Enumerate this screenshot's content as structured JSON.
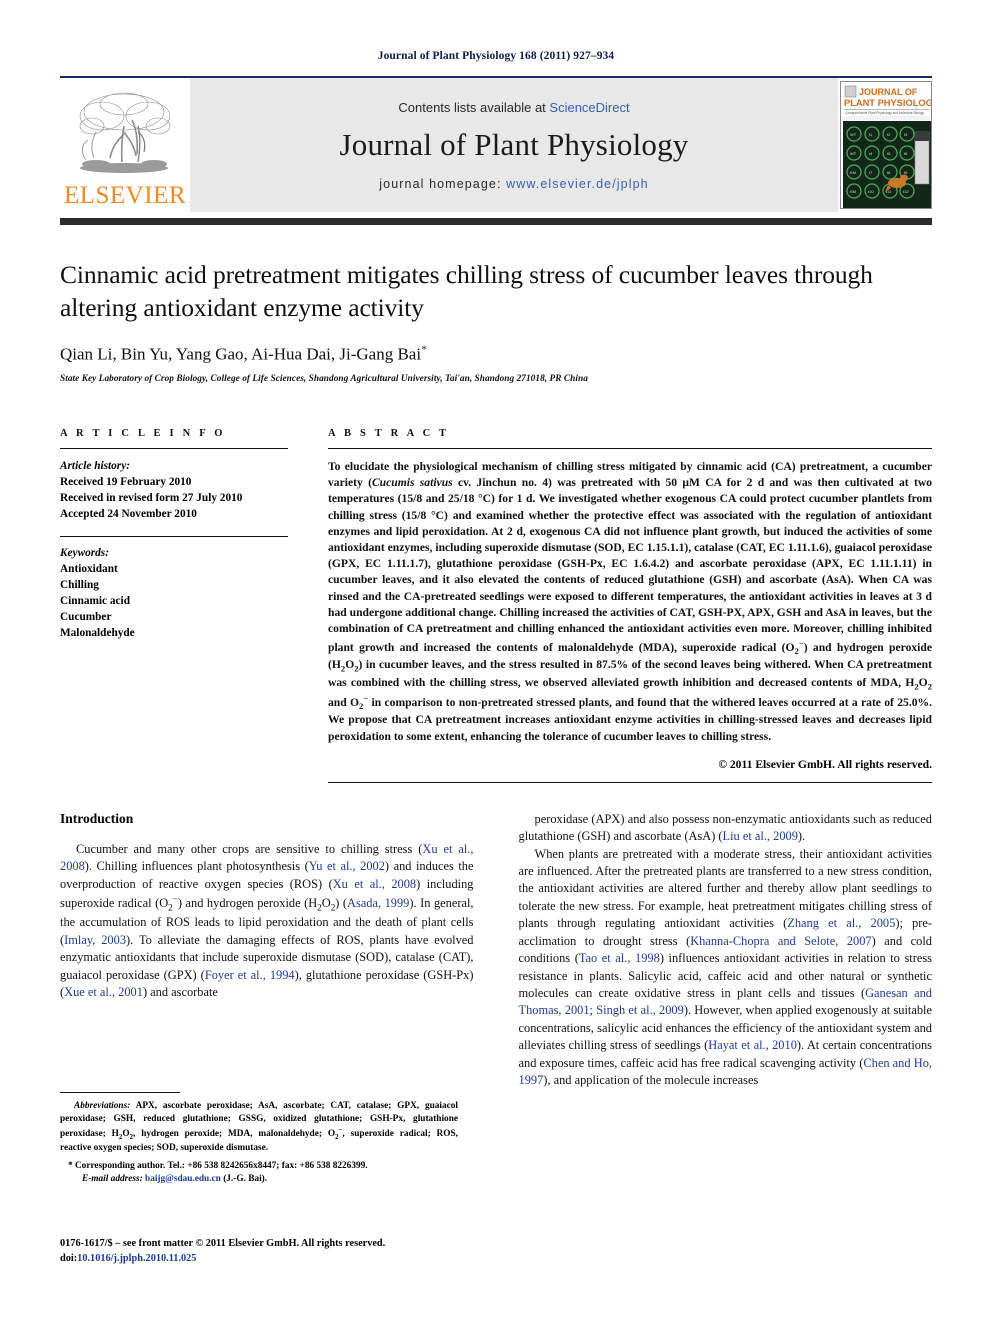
{
  "running_head": "Journal of Plant Physiology 168 (2011) 927–934",
  "masthead": {
    "contents_prefix": "Contents lists available at ",
    "sciencedirect": "ScienceDirect",
    "journal_title": "Journal of Plant Physiology",
    "homepage_prefix": "journal homepage: ",
    "homepage_url": "www.elsevier.de/jplph",
    "publisher_logo_text": "ELSEVIER",
    "cover_title_line1": "JOURNAL OF",
    "cover_title_line2": "PLANT PHYSIOLOGY",
    "accent_orange": "#f08a24",
    "link_blue": "#3a5fb5",
    "rule_navy": "#1b2a63"
  },
  "article": {
    "title": "Cinnamic acid pretreatment mitigates chilling stress of cucumber leaves through altering antioxidant enzyme activity",
    "authors": "Qian Li, Bin Yu, Yang Gao, Ai-Hua Dai, Ji-Gang Bai",
    "corresponding_marker": "*",
    "affiliation": "State Key Laboratory of Crop Biology, College of Life Sciences, Shandong Agricultural University, Tai'an, Shandong 271018, PR China"
  },
  "article_info": {
    "heading": "A R T I C L E   I N F O",
    "history_label": "Article history:",
    "history": [
      "Received 19 February 2010",
      "Received in revised form 27 July 2010",
      "Accepted 24 November 2010"
    ],
    "keywords_label": "Keywords:",
    "keywords": [
      "Antioxidant",
      "Chilling",
      "Cinnamic acid",
      "Cucumber",
      "Malonaldehyde"
    ]
  },
  "abstract": {
    "heading": "A B S T R A C T",
    "paragraphs": [
      "To elucidate the physiological mechanism of chilling stress mitigated by cinnamic acid (CA) pretreatment, a cucumber variety (Cucumis sativus cv. Jinchun no. 4) was pretreated with 50 μM CA for 2 d and was then cultivated at two temperatures (15/8 and 25/18 °C) for 1 d. We investigated whether exogenous CA could protect cucumber plantlets from chilling stress (15/8 °C) and examined whether the protective effect was associated with the regulation of antioxidant enzymes and lipid peroxidation. At 2 d, exogenous CA did not influence plant growth, but induced the activities of some antioxidant enzymes, including superoxide dismutase (SOD, EC 1.15.1.1), catalase (CAT, EC 1.11.1.6), guaiacol peroxidase (GPX, EC 1.11.1.7), glutathione peroxidase (GSH-Px, EC 1.6.4.2) and ascorbate peroxidase (APX, EC 1.11.1.11) in cucumber leaves, and it also elevated the contents of reduced glutathione (GSH) and ascorbate (AsA). When CA was rinsed and the CA-pretreated seedlings were exposed to different temperatures, the antioxidant activities in leaves at 3 d had undergone additional change. Chilling increased the activities of CAT, GSH-PX, APX, GSH and AsA in leaves, but the combination of CA pretreatment and chilling enhanced the antioxidant activities even more. Moreover, chilling inhibited plant growth and increased the contents of malonaldehyde (MDA), superoxide radical (O2−) and hydrogen peroxide (H2O2) in cucumber leaves, and the stress resulted in 87.5% of the second leaves being withered. When CA pretreatment was combined with the chilling stress, we observed alleviated growth inhibition and decreased contents of MDA, H2O2 and O2− in comparison to non-pretreated stressed plants, and found that the withered leaves occurred at a rate of 25.0%. We propose that CA pretreatment increases antioxidant enzyme activities in chilling-stressed leaves and decreases lipid peroxidation to some extent, enhancing the tolerance of cucumber leaves to chilling stress."
    ],
    "italic_species": "Cucumis sativus",
    "copyright": "© 2011 Elsevier GmbH. All rights reserved."
  },
  "introduction": {
    "heading": "Introduction",
    "left_paragraph": "Cucumber and many other crops are sensitive to chilling stress (Xu et al., 2008). Chilling influences plant photosynthesis (Yu et al., 2002) and induces the overproduction of reactive oxygen species (ROS) (Xu et al., 2008) including superoxide radical (O2−) and hydrogen peroxide (H2O2) (Asada, 1999). In general, the accumulation of ROS leads to lipid peroxidation and the death of plant cells (Imlay, 2003). To alleviate the damaging effects of ROS, plants have evolved enzymatic antioxidants that include superoxide dismutase (SOD), catalase (CAT), guaiacol peroxidase (GPX) (Foyer et al., 1994), glutathione peroxidase (GSH-Px) (Xue et al., 2001) and ascorbate",
    "right_paragraph_1": "peroxidase (APX) and also possess non-enzymatic antioxidants such as reduced glutathione (GSH) and ascorbate (AsA) (Liu et al., 2009).",
    "right_paragraph_2": "When plants are pretreated with a moderate stress, their antioxidant activities are influenced. After the pretreated plants are transferred to a new stress condition, the antioxidant activities are altered further and thereby allow plant seedlings to tolerate the new stress. For example, heat pretreatment mitigates chilling stress of plants through regulating antioxidant activities (Zhang et al., 2005); pre-acclimation to drought stress (Khanna-Chopra and Selote, 2007) and cold conditions (Tao et al., 1998) influences antioxidant activities in relation to stress resistance in plants. Salicylic acid, caffeic acid and other natural or synthetic molecules can create oxidative stress in plant cells and tissues (Ganesan and Thomas, 2001; Singh et al., 2009). However, when applied exogenously at suitable concentrations, salicylic acid enhances the efficiency of the antioxidant system and alleviates chilling stress of seedlings (Hayat et al., 2010). At certain concentrations and exposure times, caffeic acid has free radical scavenging activity (Chen and Ho, 1997), and application of the molecule increases",
    "citation_color": "#1f3a93"
  },
  "footnotes": {
    "abbreviations_label": "Abbreviations:",
    "abbreviations_text": "APX, ascorbate peroxidase; AsA, ascorbate; CAT, catalase; GPX, guaiacol peroxidase; GSH, reduced glutathione; GSSG, oxidized glutathione; GSH-Px, glutathione peroxidase; H2O2, hydrogen peroxide; MDA, malonaldehyde; O2−, superoxide radical; ROS, reactive oxygen species; SOD, superoxide dismutase.",
    "corresponding": "* Corresponding author. Tel.: +86 538 8242656x8447; fax: +86 538 8226399.",
    "email_label": "E-mail address:",
    "email": "baijg@sdau.edu.cn",
    "email_suffix": "(J.-G. Bai)."
  },
  "frontmatter": {
    "line1": "0176-1617/$ – see front matter © 2011 Elsevier GmbH. All rights reserved.",
    "doi_label": "doi:",
    "doi": "10.1016/j.jplph.2010.11.025"
  }
}
